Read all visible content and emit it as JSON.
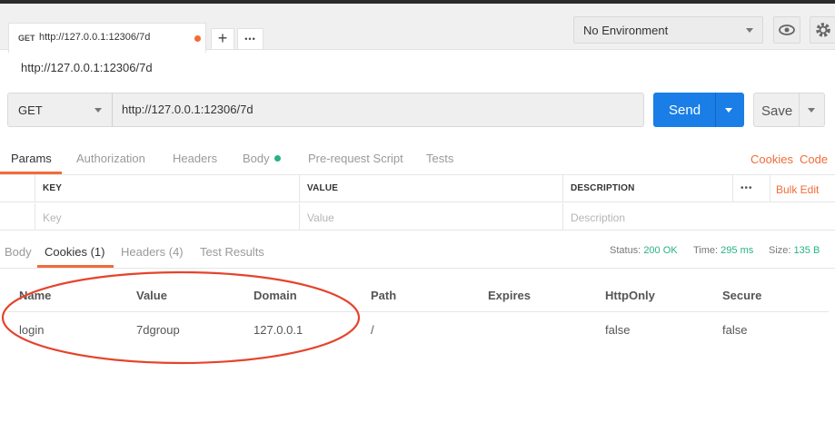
{
  "tab": {
    "method": "GET",
    "url": "http://127.0.0.1:12306/7d"
  },
  "tab_actions": {
    "add": "+",
    "more": "•••"
  },
  "environment": {
    "selected": "No Environment"
  },
  "request": {
    "title": "http://127.0.0.1:12306/7d",
    "method": "GET",
    "url": "http://127.0.0.1:12306/7d",
    "send_label": "Send",
    "save_label": "Save"
  },
  "request_tabs": [
    "Params",
    "Authorization",
    "Headers",
    "Body",
    "Pre-request Script",
    "Tests"
  ],
  "request_links": {
    "cookies": "Cookies",
    "code": "Code"
  },
  "params": {
    "headers": [
      "KEY",
      "VALUE",
      "DESCRIPTION"
    ],
    "more": "•••",
    "bulk_edit": "Bulk Edit",
    "placeholders": [
      "Key",
      "Value",
      "Description"
    ]
  },
  "response_tabs": [
    "Body",
    "Cookies (1)",
    "Headers (4)",
    "Test Results"
  ],
  "status": {
    "status_label": "Status:",
    "status_value": "200 OK",
    "time_label": "Time:",
    "time_value": "295 ms",
    "size_label": "Size:",
    "size_value": "135 B"
  },
  "cookies": {
    "headers": [
      "Name",
      "Value",
      "Domain",
      "Path",
      "Expires",
      "HttpOnly",
      "Secure"
    ],
    "rows": [
      [
        "login",
        "7dgroup",
        "127.0.0.1",
        "/",
        "",
        "false",
        "false"
      ]
    ]
  },
  "colors": {
    "accent": "#f26b3a",
    "send": "#1a7ee6",
    "success": "#26b47f",
    "annotation": "#e5442c"
  }
}
